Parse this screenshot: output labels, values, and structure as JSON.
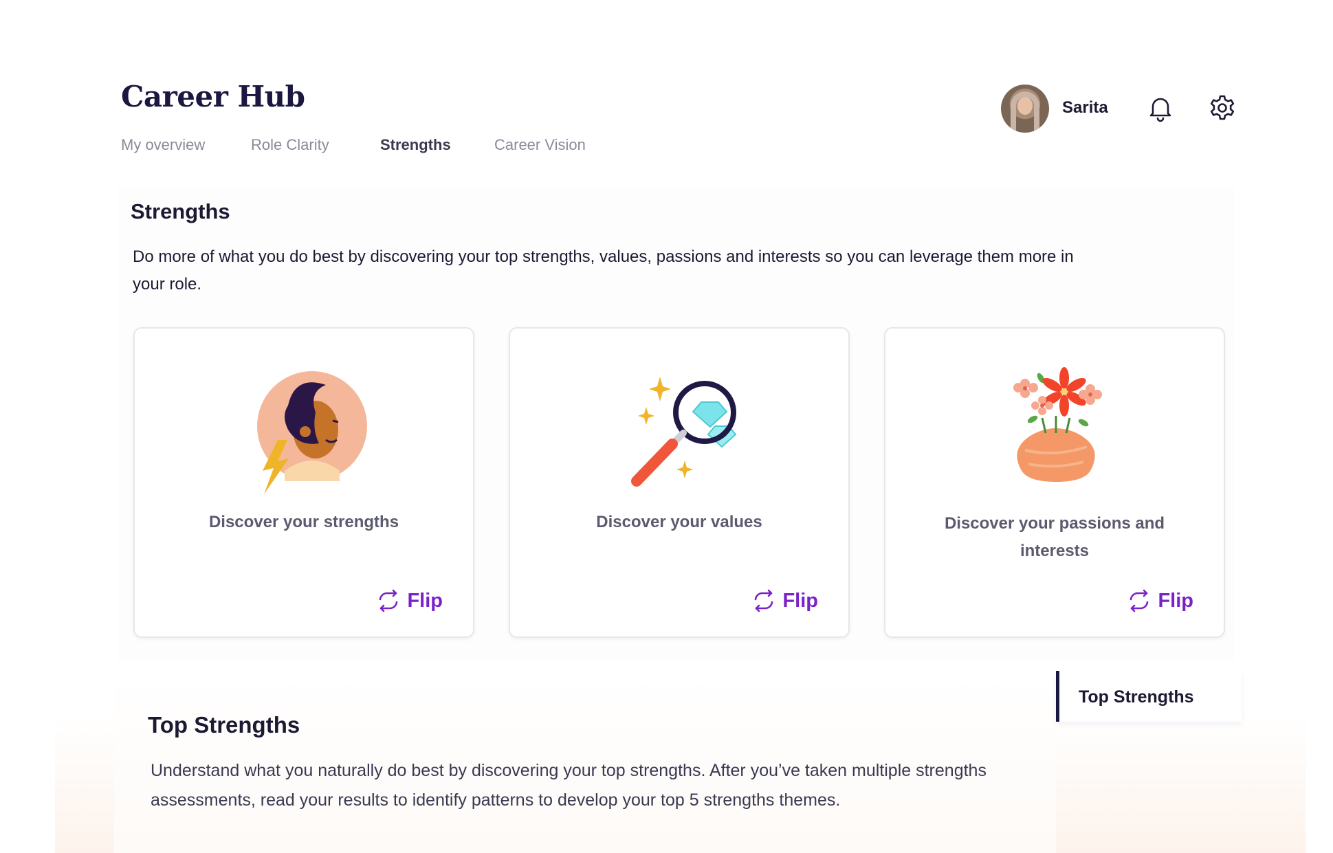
{
  "app": {
    "title": "Career Hub"
  },
  "nav": {
    "tabs": [
      {
        "label": "My overview",
        "active": false
      },
      {
        "label": "Role Clarity",
        "active": false
      },
      {
        "label": "Strengths",
        "active": true
      },
      {
        "label": "Career Vision",
        "active": false
      }
    ]
  },
  "user": {
    "name": "Sarita",
    "icons": [
      "bell-icon",
      "gear-icon"
    ]
  },
  "strengths": {
    "title": "Strengths",
    "description": "Do more of what you do best by discovering your top strengths, values, passions and interests so you can leverage them more in your role.",
    "cards": [
      {
        "label": "Discover your strengths",
        "action": "Flip",
        "icon": "person-lightning-illustration"
      },
      {
        "label": "Discover your values",
        "action": "Flip",
        "icon": "magnifier-diamond-illustration"
      },
      {
        "label": "Discover your passions and interests",
        "action": "Flip",
        "icon": "flower-vase-illustration"
      }
    ]
  },
  "top_strengths": {
    "title": "Top Strengths",
    "description": "Understand what you naturally do best by discovering your top strengths. After you’ve taken multiple strengths assessments, read your results to identify patterns to develop your top 5 strengths themes."
  },
  "side_nav": {
    "items": [
      {
        "label": "Top Strengths"
      }
    ]
  },
  "colors": {
    "accent": "#7a22c9",
    "heading": "#1a1740",
    "muted": "#8b8a99"
  }
}
